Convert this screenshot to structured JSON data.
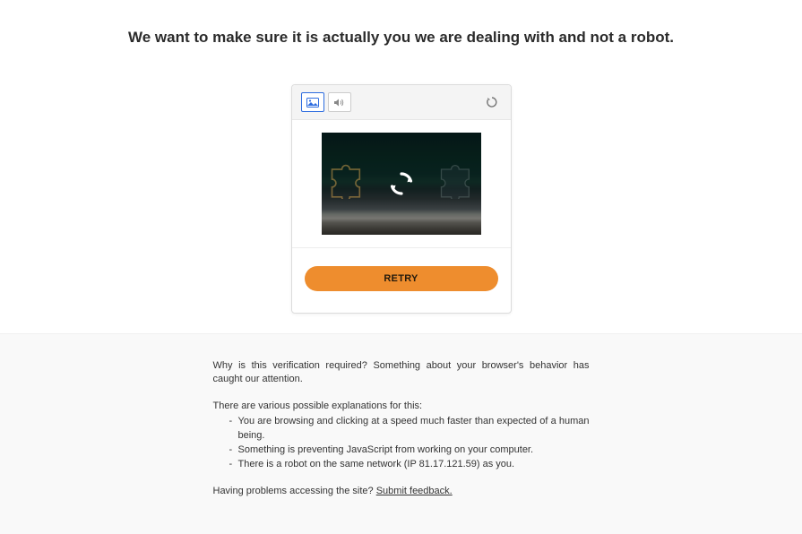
{
  "heading": "We want to make sure it is actually you we are dealing with and not a robot.",
  "captcha": {
    "retry_label": "RETRY"
  },
  "info": {
    "why_required": "Why is this verification required? Something about your browser's behavior has caught our attention.",
    "explanations_intro": "There are various possible explanations for this:",
    "reasons": {
      "r1": "You are browsing and clicking at a speed much faster than expected of a human being.",
      "r2": "Something is preventing JavaScript from working on your computer.",
      "r3": "There is a robot on the same network (IP 81.17.121.59) as you."
    },
    "problems_prefix": "Having problems accessing the site? ",
    "submit_feedback": "Submit feedback."
  }
}
